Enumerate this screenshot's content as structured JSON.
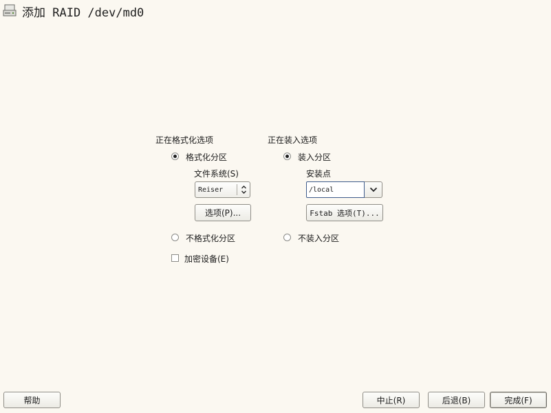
{
  "window": {
    "title": "添加 RAID /dev/md0",
    "icon": "harddisk-icon"
  },
  "formatting": {
    "group_label": "正在格式化选项",
    "format_option_label": "格式化分区",
    "format_selected": true,
    "filesystem_label": "文件系统(S)",
    "filesystem_value": "Reiser",
    "options_button": "选项(P)...",
    "no_format_label": "不格式化分区",
    "encrypt_label": "加密设备(E)",
    "encrypt_checked": false
  },
  "mounting": {
    "group_label": "正在装入选项",
    "mount_option_label": "装入分区",
    "mount_selected": true,
    "mount_point_label": "安装点",
    "mount_point_value": "/local",
    "fstab_button": "Fstab 选项(T)...",
    "no_mount_label": "不装入分区"
  },
  "footer": {
    "help_button": "帮助",
    "abort_button": "中止(R)",
    "back_button": "后退(B)",
    "finish_button": "完成(F)"
  },
  "colors": {
    "background": "#fbf8f1",
    "focus_border": "#3c5a8a"
  }
}
